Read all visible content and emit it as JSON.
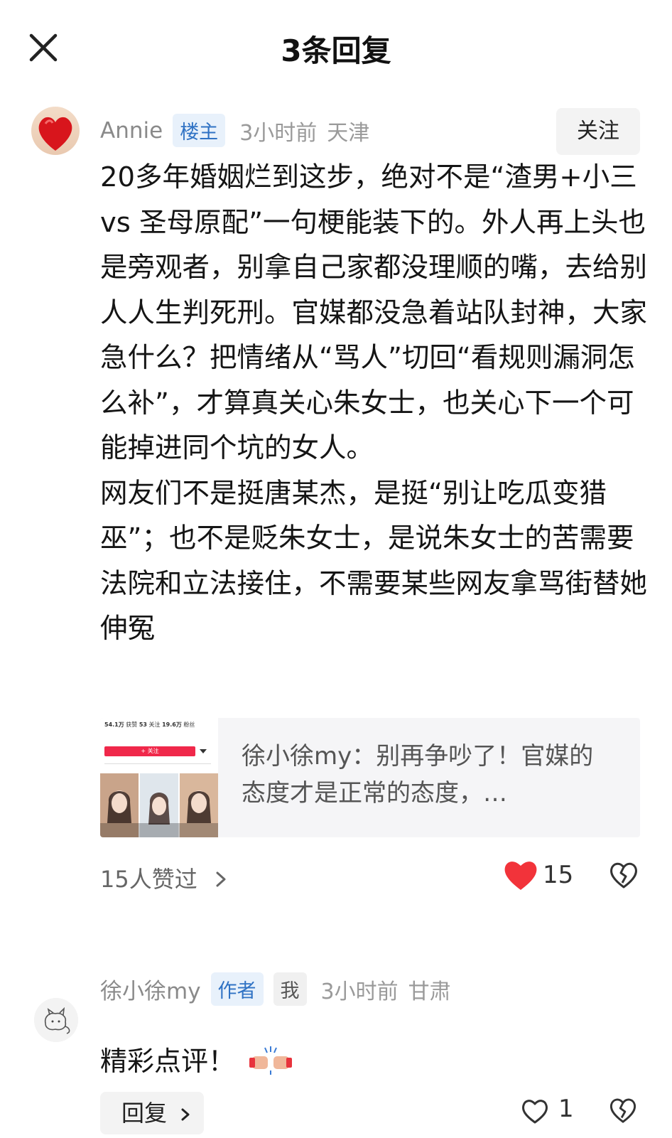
{
  "header": {
    "title": "3条回复"
  },
  "main_comment": {
    "username": "Annie",
    "owner_tag": "楼主",
    "time": "3小时前",
    "location": "天津",
    "follow_label": "关注",
    "paragraphs": [
      "20多年婚姻烂到这步，绝对不是“渣男+小三 vs 圣母原配”一句梗能装下的。外人再上头也是旁观者，别拿自己家都没理顺的嘴，去给别人人生判死刑。官媒都没急着站队封神，大家急什么？把情绪从“骂人”切回“看规则漏洞怎么补”，才算真关心朱女士，也关心下一个可能掉进同个坑的女人。",
      "网友们不是挺唐某杰，是挺“别让吃瓜变猎巫”；也不是贬朱女士，是说朱女士的苦需要法院和立法接住，不需要某些网友拿骂街替她伸冤"
    ],
    "quote": {
      "text": "徐小徐my：别再争吵了！官媒的态度才是正常的态度，…",
      "thumb": {
        "stats": [
          "54.1万",
          "获赞",
          "53",
          "关注",
          "19.6万",
          "粉丝"
        ],
        "button": "+ 关注"
      }
    },
    "liked_by": "15人赞过",
    "like_count": "15"
  },
  "reply": {
    "username": "徐小徐my",
    "author_tag": "作者",
    "me_tag": "我",
    "time": "3小时前",
    "location": "甘肃",
    "content": "精彩点评！",
    "reply_label": "回复",
    "like_count": "1"
  },
  "colors": {
    "heart": "#f2333a",
    "tag_blue": "#2f72c4",
    "tag_bg": "#e8f1fb"
  }
}
